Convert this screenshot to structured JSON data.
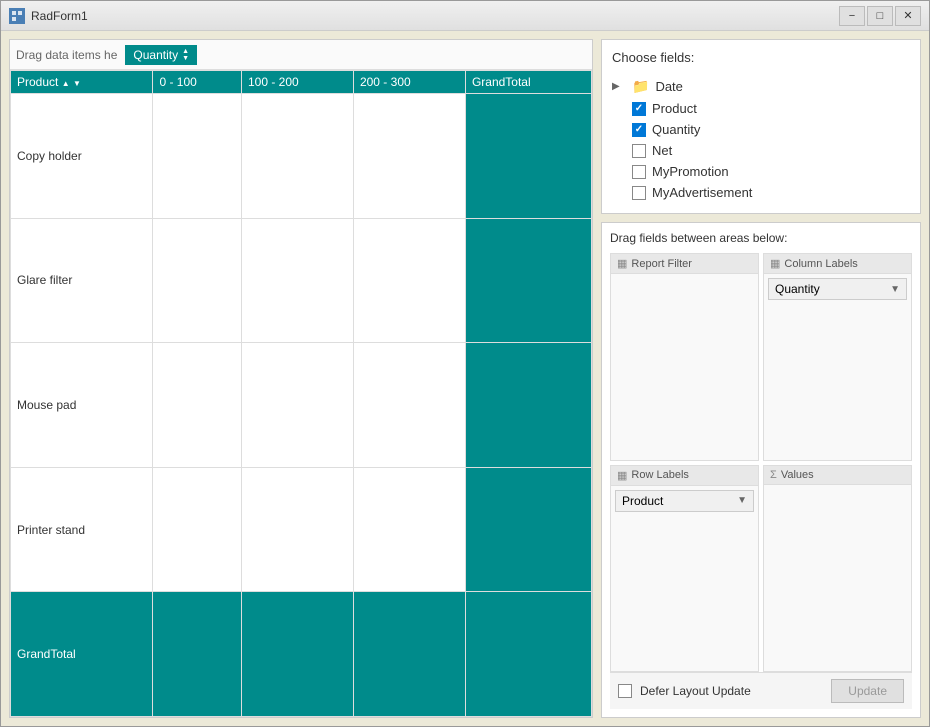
{
  "window": {
    "title": "RadForm1",
    "minimize_label": "−",
    "maximize_label": "□",
    "close_label": "✕"
  },
  "left_panel": {
    "drag_header_text": "Drag data items he",
    "quantity_chip_label": "Quantity",
    "table": {
      "headers": [
        "Product",
        "0 - 100",
        "100 - 200",
        "200 - 300",
        "GrandTotal"
      ],
      "rows": [
        {
          "label": "Copy holder",
          "vals": [
            "",
            "",
            "",
            ""
          ]
        },
        {
          "label": "Glare filter",
          "vals": [
            "",
            "",
            "",
            ""
          ]
        },
        {
          "label": "Mouse pad",
          "vals": [
            "",
            "",
            "",
            ""
          ]
        },
        {
          "label": "Printer stand",
          "vals": [
            "",
            "",
            "",
            ""
          ]
        },
        {
          "label": "GrandTotal",
          "vals": [
            "",
            "",
            "",
            ""
          ],
          "is_grand": true
        }
      ]
    }
  },
  "right_panel": {
    "fields_title": "Choose fields:",
    "fields": [
      {
        "type": "folder",
        "label": "Date",
        "expanded": false
      },
      {
        "type": "checked",
        "label": "Product"
      },
      {
        "type": "checked",
        "label": "Quantity"
      },
      {
        "type": "unchecked",
        "label": "Net"
      },
      {
        "type": "unchecked",
        "label": "MyPromotion"
      },
      {
        "type": "unchecked",
        "label": "MyAdvertisement"
      }
    ],
    "drag_areas_title": "Drag fields between areas below:",
    "report_filter_label": "Report Filter",
    "column_labels_label": "Column Labels",
    "row_labels_label": "Row Labels",
    "values_label": "Values",
    "column_chip": "Quantity",
    "row_chip": "Product",
    "defer_label": "Defer Layout Update",
    "update_btn_label": "Update"
  }
}
